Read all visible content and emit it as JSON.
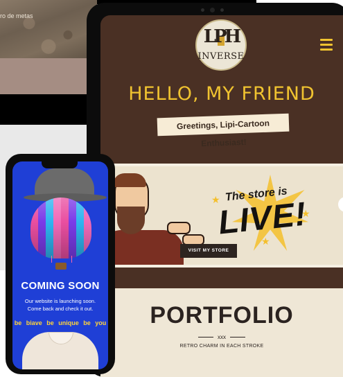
{
  "background_site": {
    "hero_text": "ro de metas"
  },
  "tablet": {
    "logo": {
      "monogram": "LPH",
      "wordmark": "INVERSE"
    },
    "hello_title": "HELLO, MY FRIEND",
    "greeting": "Greetings, Lipi-Cartoon Enthusiast!",
    "store_banner": {
      "line1": "The store is",
      "line2": "LIVE!",
      "button_label": "VISIT MY STORE"
    },
    "portfolio": {
      "title": "PORTFOLIO",
      "divider": "xxx",
      "subtitle": "RETRO CHARM IN EACH STROKE"
    },
    "icons": [
      "menu-icon",
      "chevron-right-icon"
    ],
    "colors": {
      "background": "#4a3024",
      "accent": "#f0c330",
      "cream": "#efe7d6"
    }
  },
  "phone": {
    "coming_soon": "COMING SOON",
    "launch_line1": "Our website is launching soon.",
    "launch_line2": "Come back and check it out.",
    "tagline": "be biave  be unique  be you",
    "colors": {
      "background": "#1f3fd6",
      "tagline": "#ffd43a"
    }
  }
}
